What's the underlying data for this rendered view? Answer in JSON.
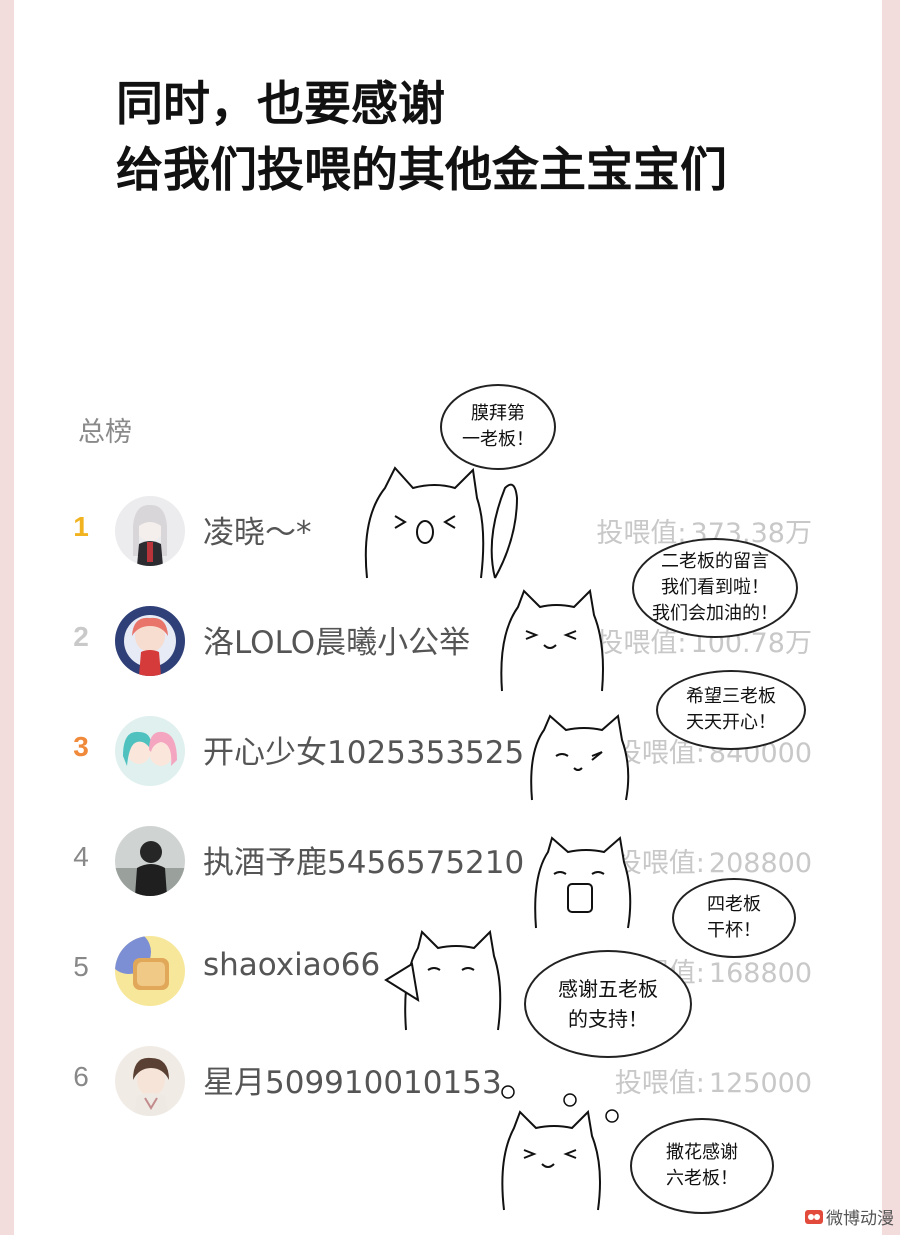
{
  "headline": {
    "line1": "同时，也要感谢",
    "line2": "给我们投喂的其他金主宝宝们"
  },
  "board": {
    "title": "总榜",
    "score_label": "投喂值:",
    "rows": [
      {
        "rank": "1",
        "name": "凌晓～*",
        "score": "373.38万"
      },
      {
        "rank": "2",
        "name": "洛LOLO晨曦小公举",
        "score": "100.78万"
      },
      {
        "rank": "3",
        "name": "开心少女1025353525",
        "score": "840000"
      },
      {
        "rank": "4",
        "name": "执酒予鹿5456575210",
        "score": "208800"
      },
      {
        "rank": "5",
        "name": "shaoxiao66",
        "score": "168800"
      },
      {
        "rank": "6",
        "name": "星月509910010153",
        "score": "125000"
      }
    ]
  },
  "bubbles": {
    "b1": {
      "line1": "膜拜第",
      "line2": "一老板！"
    },
    "b2": {
      "line1": "二老板的留言",
      "line2": "我们看到啦！",
      "line3": "我们会加油的！"
    },
    "b3": {
      "line1": "希望三老板",
      "line2": "天天开心！"
    },
    "b4": {
      "line1": "四老板",
      "line2": "干杯！"
    },
    "b5": {
      "line1": "感谢五老板",
      "line2": "的支持！"
    },
    "b6": {
      "line1": "撒花感谢",
      "line2": "六老板！"
    }
  },
  "watermark": {
    "text": "微博动漫"
  },
  "colors": {
    "rank1": "#f2b320",
    "rank2": "#c9c9c9",
    "rank3": "#f08a3a",
    "border_pink": "#f3dcdc"
  }
}
